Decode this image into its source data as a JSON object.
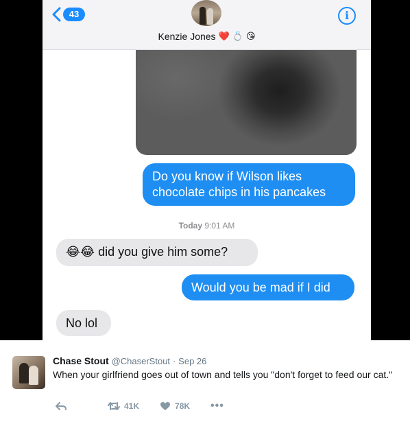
{
  "header": {
    "back_count": "43",
    "contact_name": "Kenzie Jones",
    "contact_emojis": [
      "❤️",
      "💍",
      "😘"
    ],
    "info_label": "i"
  },
  "messages": [
    {
      "side": "out",
      "text_line1": "Do you know if Wilson likes",
      "text_line2": "chocolate chips in his pancakes"
    },
    {
      "side": "in",
      "emoji": "😂😂",
      "text": "did you give him some?"
    },
    {
      "side": "out",
      "text": "Would you be mad if I did"
    },
    {
      "side": "in",
      "text": "No lol"
    }
  ],
  "timestamp": {
    "day": "Today",
    "time": "9:01 AM"
  },
  "tweet": {
    "name": "Chase Stout",
    "handle": "@ChaserStout",
    "separator": "·",
    "date": "Sep 26",
    "text": "When your girlfriend goes out of town and tells you \"don't forget to feed our cat.\"",
    "retweets": "41K",
    "likes": "78K",
    "more": "•••"
  },
  "colors": {
    "accent": "#1a8cff",
    "outgoing_bubble": "#1e8ef2",
    "incoming_bubble": "#e7e7ea",
    "tweet_meta": "#657786"
  },
  "icons": {
    "back": "chevron-left-icon",
    "info": "info-icon",
    "reply": "reply-icon",
    "retweet": "retweet-icon",
    "like": "heart-icon",
    "more": "more-icon"
  }
}
